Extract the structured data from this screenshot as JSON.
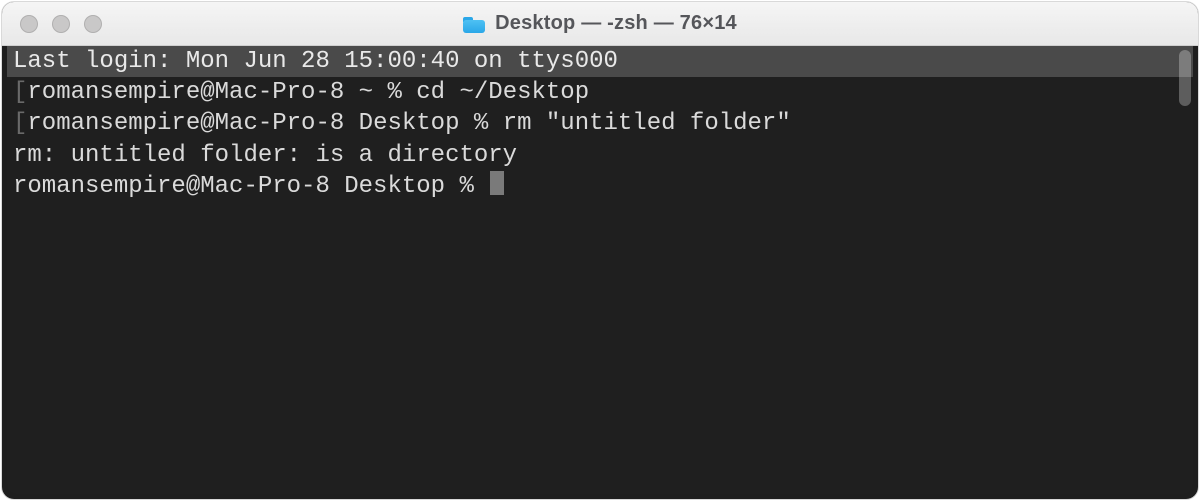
{
  "titlebar": {
    "title": "Desktop — -zsh — 76×14"
  },
  "terminal": {
    "lines": {
      "l0": "Last login: Mon Jun 28 15:00:40 on ttys000",
      "l1_prompt": "romansempire@Mac-Pro-8 ~ % ",
      "l1_cmd": "cd ~/Desktop",
      "l2_prompt": "romansempire@Mac-Pro-8 Desktop % ",
      "l2_cmd": "rm \"untitled folder\"",
      "l3": "rm: untitled folder: is a directory",
      "l4_prompt": "romansempire@Mac-Pro-8 Desktop % "
    }
  }
}
